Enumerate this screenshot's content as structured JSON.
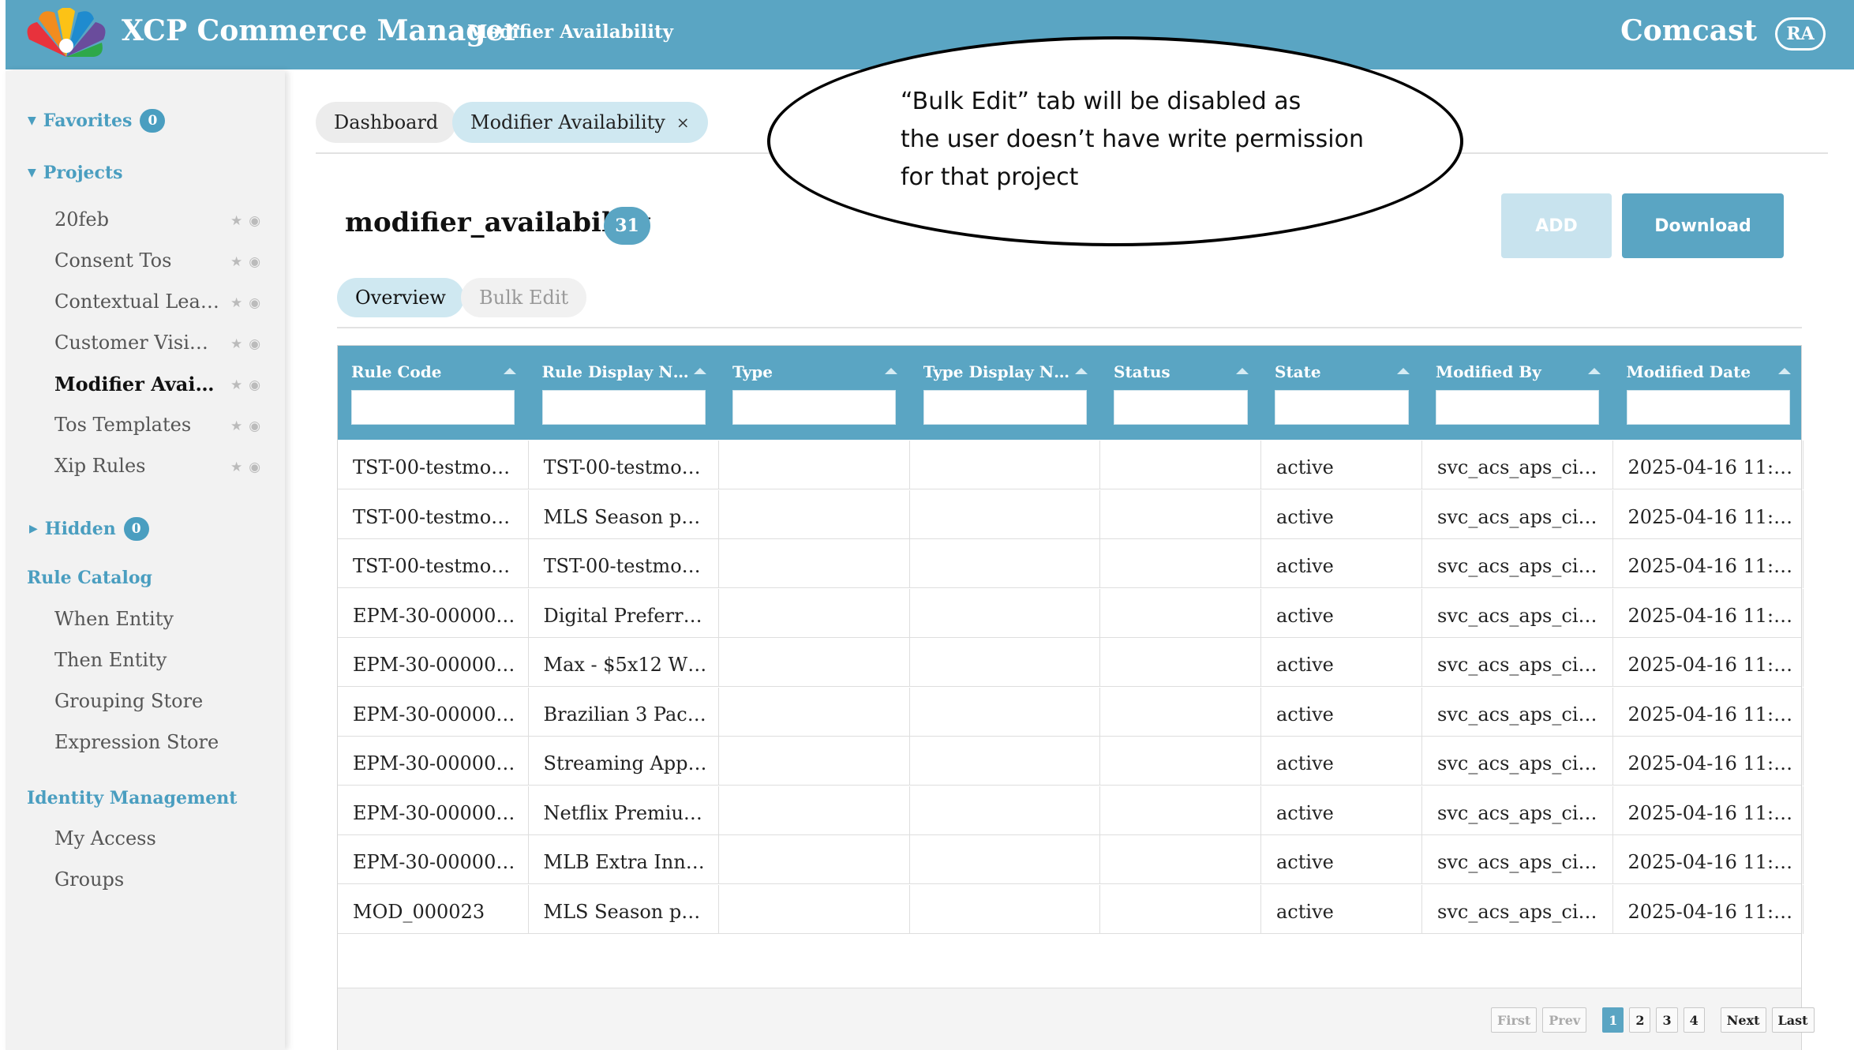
{
  "header": {
    "app_title": "XCP Commerce Manager",
    "page_subtitle": "Modifier Availability",
    "brand": "Comcast",
    "avatar_initials": "RA",
    "bar_color": "#5aa5c3"
  },
  "sidebar": {
    "favorites": {
      "label": "Favorites",
      "count": "0"
    },
    "projects": {
      "label": "Projects",
      "items": [
        {
          "label": "20feb"
        },
        {
          "label": "Consent Tos"
        },
        {
          "label": "Contextual Lear…"
        },
        {
          "label": "Customer Visibility"
        },
        {
          "label": "Modifier Availa…",
          "active": true
        },
        {
          "label": "Tos Templates"
        },
        {
          "label": "Xip Rules"
        }
      ]
    },
    "hidden": {
      "label": "Hidden",
      "count": "0"
    },
    "rule_catalog": {
      "label": "Rule Catalog",
      "items": [
        {
          "label": "When Entity"
        },
        {
          "label": "Then Entity"
        },
        {
          "label": "Grouping Store"
        },
        {
          "label": "Expression Store"
        }
      ]
    },
    "identity_management": {
      "label": "Identity Management",
      "items": [
        {
          "label": "My Access"
        },
        {
          "label": "Groups"
        }
      ]
    }
  },
  "page_tabs": {
    "dashboard": "Dashboard",
    "modifier_availability": "Modifier Availability",
    "close_glyph": "×"
  },
  "callout": {
    "lines": [
      "“Bulk Edit” tab will be disabled as",
      "the user doesn’t have write permission",
      "for that project"
    ]
  },
  "main": {
    "title": "modifier_availability",
    "count": "31",
    "add_label": "ADD",
    "download_label": "Download",
    "subtabs": {
      "overview": "Overview",
      "bulk_edit": "Bulk Edit"
    }
  },
  "table": {
    "columns": [
      "Rule Code",
      "Rule Display Na…",
      "Type",
      "Type Display N…",
      "Status",
      "State",
      "Modified By",
      "Modified Date"
    ],
    "rows": [
      [
        "TST-00-testmod…",
        "TST-00-testmod…",
        "",
        "",
        "",
        "active",
        "svc_acs_aps_ci…",
        "2025-04-16 11:…"
      ],
      [
        "TST-00-testmod…",
        "MLS Season pa…",
        "",
        "",
        "",
        "active",
        "svc_acs_aps_ci…",
        "2025-04-16 11:…"
      ],
      [
        "TST-00-testmod…",
        "TST-00-testmod…",
        "",
        "",
        "",
        "active",
        "svc_acs_aps_ci…",
        "2025-04-16 11:…"
      ],
      [
        "EPM-30-00000…",
        "Digital Preferre…",
        "",
        "",
        "",
        "active",
        "svc_acs_aps_ci…",
        "2025-04-16 11:…"
      ],
      [
        "EPM-30-00000…",
        "Max - $5x12 W…",
        "",
        "",
        "",
        "active",
        "svc_acs_aps_ci…",
        "2025-04-16 11:…"
      ],
      [
        "EPM-30-00000…",
        "Brazilian 3 Pac…",
        "",
        "",
        "",
        "active",
        "svc_acs_aps_ci…",
        "2025-04-16 11:…"
      ],
      [
        "EPM-30-00000…",
        "Streaming App …",
        "",
        "",
        "",
        "active",
        "svc_acs_aps_ci…",
        "2025-04-16 11:…"
      ],
      [
        "EPM-30-00000…",
        "Netflix Premiu…",
        "",
        "",
        "",
        "active",
        "svc_acs_aps_ci…",
        "2025-04-16 11:…"
      ],
      [
        "EPM-30-00000…",
        "MLB Extra Inni…",
        "",
        "",
        "",
        "active",
        "svc_acs_aps_ci…",
        "2025-04-16 11:…"
      ],
      [
        "MOD_000023",
        "MLS Season pa…",
        "",
        "",
        "",
        "active",
        "svc_acs_aps_ci…",
        "2025-04-16 11:…"
      ]
    ]
  },
  "pagination": {
    "first": "First",
    "prev": "Prev",
    "pages": [
      "1",
      "2",
      "3",
      "4"
    ],
    "current_page": "1",
    "next": "Next",
    "last": "Last"
  }
}
